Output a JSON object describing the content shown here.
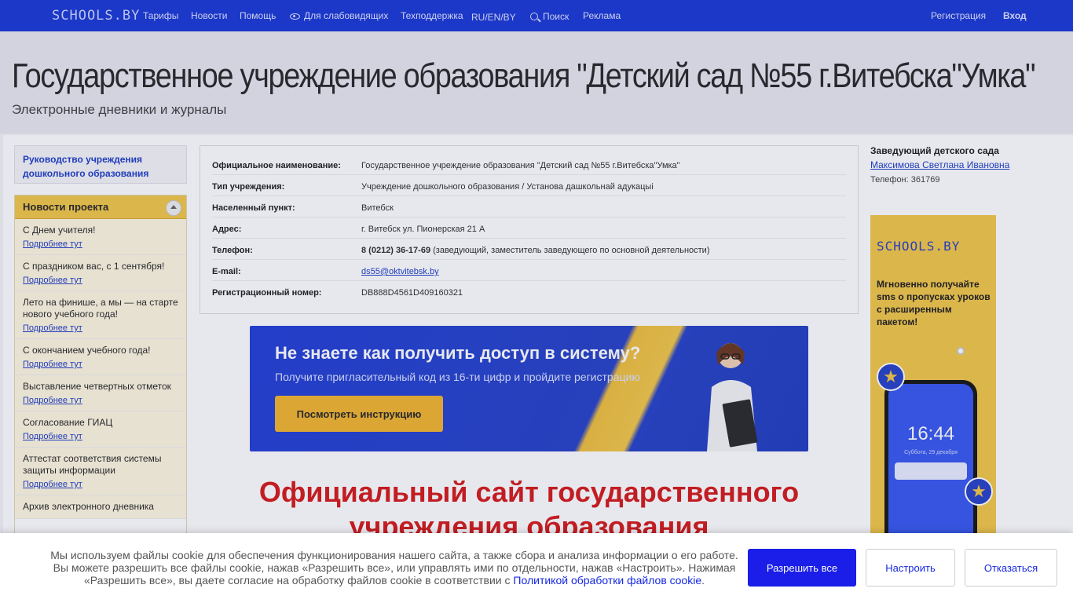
{
  "topnav": {
    "logo": "SCHOOLS.BY",
    "items": [
      "Тарифы",
      "Новости",
      "Помощь",
      "Для слабовидящих",
      "Техподдержка",
      "RU/EN/BY",
      "Поиск",
      "Реклама"
    ],
    "register": "Регистрация",
    "login": "Вход"
  },
  "header": {
    "title": "Государственное учреждение образования \"Детский сад №55 г.Витебска\"Умка\"",
    "subtitle": "Электронные дневники и журналы"
  },
  "sidebar": {
    "leadership_link": "Руководство учреждения дошкольного образования",
    "news_title": "Новости проекта",
    "news": [
      {
        "title": "С Днем учителя!",
        "link": "Подробнее тут"
      },
      {
        "title": "С праздником вас, с 1 сентября!",
        "link": "Подробнее тут"
      },
      {
        "title": "Лето на финише, а мы — на старте нового учебного года!",
        "link": "Подробнее тут"
      },
      {
        "title": "С окончанием учебного года!",
        "link": "Подробнее тут"
      },
      {
        "title": "Выставление четвертных отметок",
        "link": "Подробнее тут"
      },
      {
        "title": "Согласование ГИАЦ",
        "link": "Подробнее тут"
      },
      {
        "title": "Аттестат соответствия системы защиты информации",
        "link": "Подробнее тут"
      },
      {
        "title": "Архив электронного дневника",
        "link": ""
      }
    ]
  },
  "info": {
    "rows": [
      {
        "label": "Официальное наименование:",
        "value": "Государственное учреждение образования \"Детский сад №55 г.Витебска\"Умка\""
      },
      {
        "label": "Тип учреждения:",
        "value": "Учреждение дошкольного образования / Установа дашкольнай адукацыі"
      },
      {
        "label": "Населенный пункт:",
        "value": "Витебск"
      },
      {
        "label": "Адрес:",
        "value": "г. Витебск ул. Пионерская 21 А"
      },
      {
        "label": "Телефон:",
        "phone": "8 (0212) 36-17-69",
        "phone_note": " (заведующий, заместитель заведующего по основной деятельности)"
      },
      {
        "label": "E-mail:",
        "email": "ds55@oktvitebsk.by"
      },
      {
        "label": "Регистрационный номер:",
        "value": "DB888D4561D409160321"
      }
    ]
  },
  "banner": {
    "title": "Не знаете как получить доступ в систему?",
    "subtitle": "Получите пригласительный код из 16-ти цифр и пройдите регистрацию",
    "button": "Посмотреть инструкцию"
  },
  "official_heading": "Официальный сайт государственного учреждения образования",
  "right": {
    "head_title": "Заведующий детского сада",
    "head_name": "Максимова Светлана Ивановна",
    "head_phone": "Телефон: 361769",
    "ad_logo": "SCHOOLS.BY",
    "ad_text": "Мгновенно получайте sms о пропусках уроков с расширенным пакетом!",
    "phone_time": "16:44",
    "phone_date": "Суббота, 29 декабря"
  },
  "cookie": {
    "text": "Мы используем файлы cookie для обеспечения функционирования нашего сайта, а также сбора и анализа информации о его работе. Вы можете разрешить все файлы cookie, нажав «Разрешить все», или управлять ими по отдельности, нажав «Настроить». Нажимая «Разрешить все», вы даете согласие на обработку файлов cookie в соответствии с ",
    "link": "Политикой обработки файлов cookie",
    "after_link": ".",
    "accept": "Разрешить все",
    "configure": "Настроить",
    "decline": "Отказаться"
  },
  "colors": {
    "nav_blue": "#1e3bd6",
    "news_yellow": "#f2c84b",
    "heading_red": "#d51e1e",
    "link_blue": "#2341c9"
  }
}
